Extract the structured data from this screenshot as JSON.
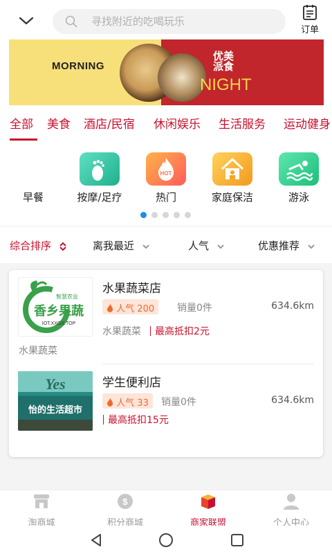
{
  "header": {
    "search_placeholder": "寻找附近的吃喝玩乐",
    "order_label": "订单"
  },
  "banner": {
    "left_text": "MORNING",
    "right_text": "NIGHT",
    "right_cn": "优美派食"
  },
  "categories": [
    "全部",
    "美食",
    "酒店/民宿",
    "休闲娱乐",
    "生活服务",
    "运动健身"
  ],
  "icons": [
    {
      "label": "早餐",
      "icon": "breakfast-icon",
      "color": "#ffffff"
    },
    {
      "label": "按摩/足疗",
      "icon": "footprint-icon",
      "color": "#2fc4a5"
    },
    {
      "label": "热门",
      "icon": "hot-icon",
      "color": "#ff6f4d"
    },
    {
      "label": "家庭保洁",
      "icon": "home-icon",
      "color": "#f5a623"
    },
    {
      "label": "游泳",
      "icon": "swim-icon",
      "color": "#2dcf8e"
    }
  ],
  "pager": {
    "total": 5,
    "active": 0
  },
  "sort": {
    "items": [
      "综合排序",
      "离我最近",
      "人气",
      "优惠推荐"
    ],
    "active_index": 0
  },
  "shops": [
    {
      "name": "水果蔬菜店",
      "popularity_label": "人气",
      "popularity": "200",
      "sales": "销量0件",
      "distance": "634.6km",
      "tag": "水果蔬菜",
      "discount": "最高抵扣2元",
      "category": "水果蔬菜",
      "logo_text": "香乡果蔬",
      "logo_sub": "智慧农业",
      "logo_url": "IOT.XXGS.TOP"
    },
    {
      "name": "学生便利店",
      "popularity_label": "人气",
      "popularity": "33",
      "sales": "销量0件",
      "distance": "634.6km",
      "tag": "",
      "discount": "最高抵扣15元",
      "category": "",
      "logo_text": "怡的生活超市"
    }
  ],
  "bottom_nav": [
    {
      "label": "淘商城",
      "icon": "store-icon"
    },
    {
      "label": "积分商城",
      "icon": "coin-icon"
    },
    {
      "label": "商家联盟",
      "icon": "gift-box-icon"
    },
    {
      "label": "个人中心",
      "icon": "person-icon"
    }
  ],
  "bottom_nav_active": 2,
  "colors": {
    "accent": "#c8102e",
    "pager_active": "#1a8ee5",
    "popularity_bg": "#fde5da",
    "popularity_text": "#ef6a2c"
  }
}
